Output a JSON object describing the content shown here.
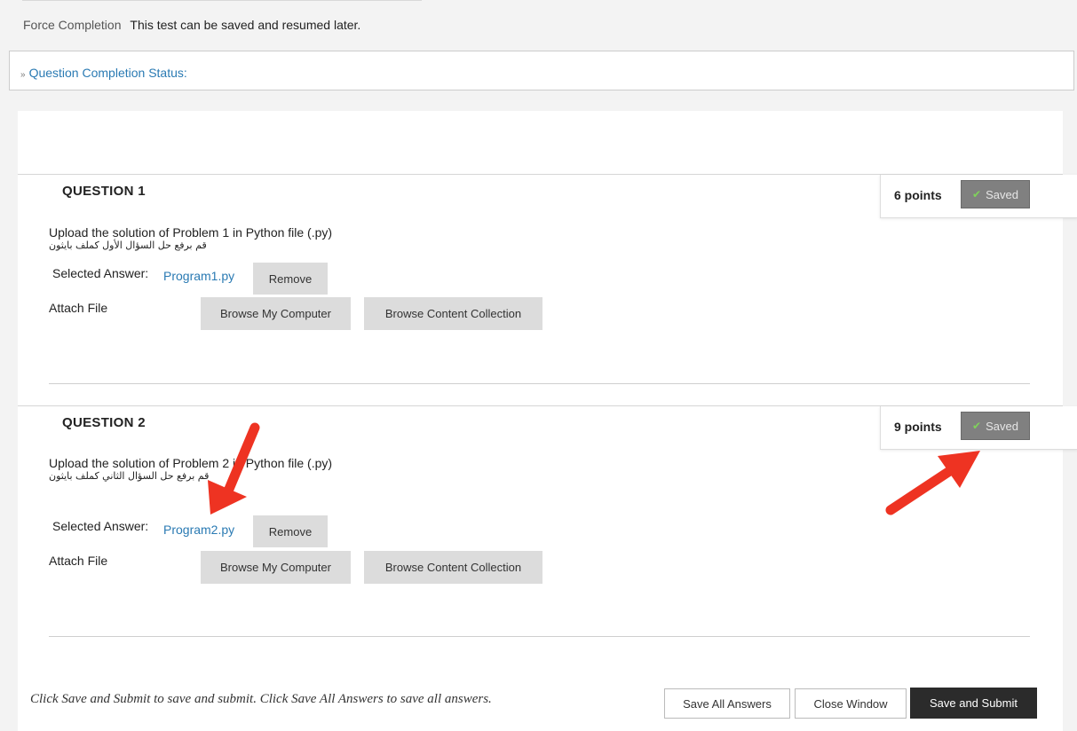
{
  "header": {
    "force_label": "Force Completion",
    "force_value": "This test can be saved and resumed later."
  },
  "status": {
    "toggle_icon": "double-chevron-down-icon",
    "label": "Question Completion Status:"
  },
  "questions": [
    {
      "title": "QUESTION 1",
      "points": "6 points",
      "saved_label": "Saved",
      "prompt": "Upload the solution of Problem 1 in Python file (.py)",
      "prompt_ar": "قم برفع حل السؤال الأول كملف بايثون",
      "selected_label": "Selected Answer:",
      "file_name": "Program1.py",
      "remove_label": "Remove",
      "attach_label": "Attach File",
      "browse_computer": "Browse My Computer",
      "browse_collection": "Browse Content Collection"
    },
    {
      "title": "QUESTION 2",
      "points": "9 points",
      "saved_label": "Saved",
      "prompt": "Upload the solution of Problem 2 in Python file (.py)",
      "prompt_ar": "قم برفع حل السؤال الثاني كملف بايثون",
      "selected_label": "Selected Answer:",
      "file_name": "Program2.py",
      "remove_label": "Remove",
      "attach_label": "Attach File",
      "browse_computer": "Browse My Computer",
      "browse_collection": "Browse Content Collection"
    }
  ],
  "footer": {
    "note": "Click Save and Submit to save and submit. Click Save All Answers to save all answers.",
    "save_all": "Save All Answers",
    "close_window": "Close Window",
    "save_submit": "Save and Submit"
  },
  "colors": {
    "link": "#2a7ab3",
    "saved_badge": "#808080",
    "check": "#7fd35a",
    "submit_button": "#2b2b2b",
    "annotation_arrow": "#ee3322"
  }
}
